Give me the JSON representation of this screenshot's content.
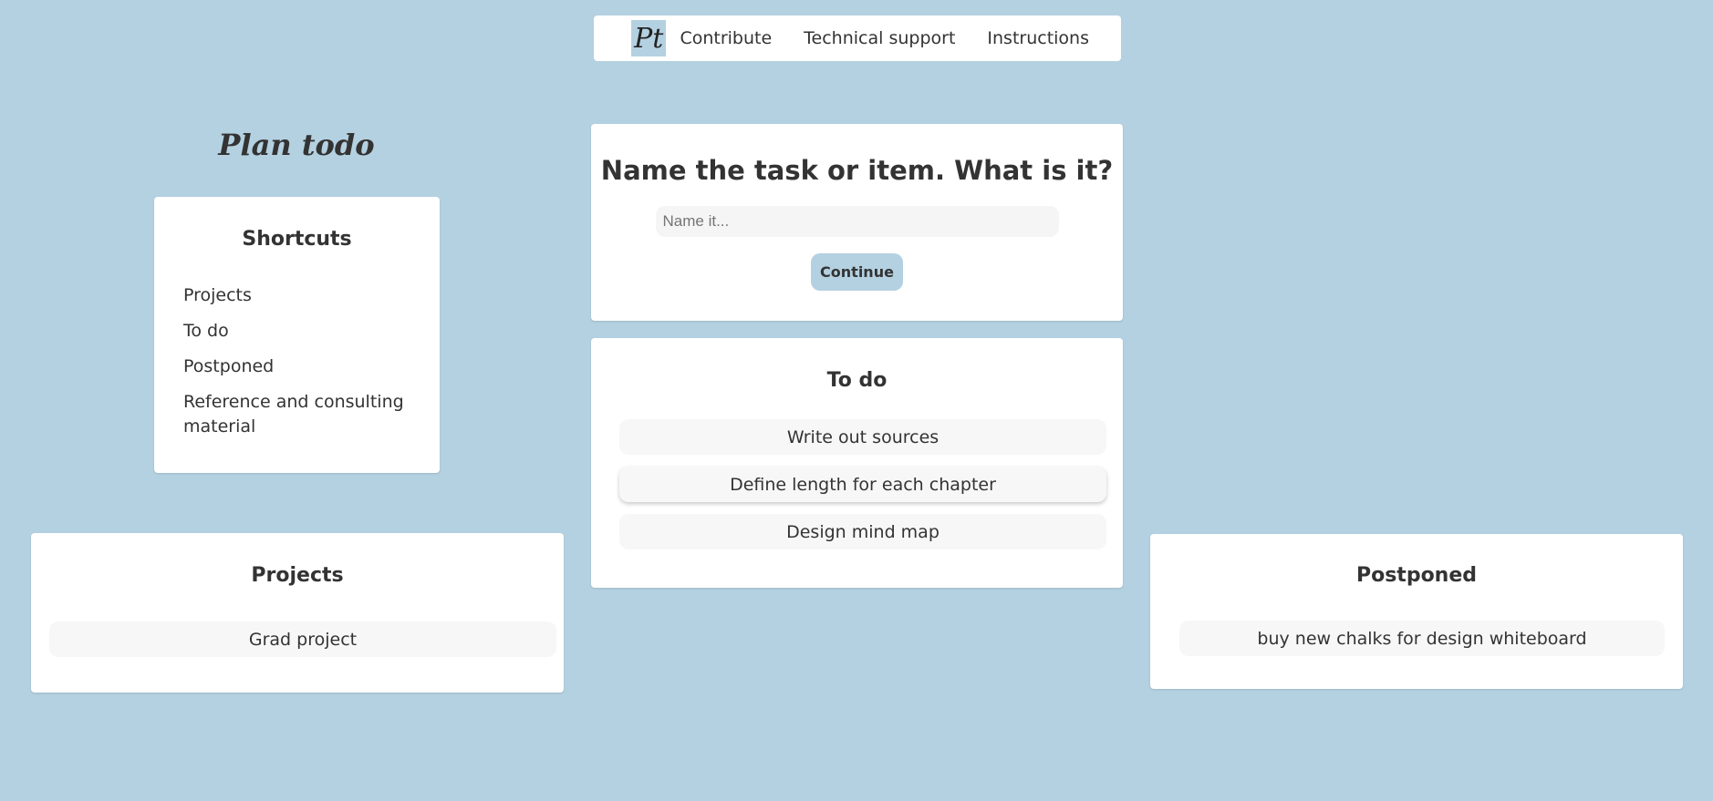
{
  "nav": {
    "logo_text": "Pt",
    "links": [
      "Contribute",
      "Technical support",
      "Instructions"
    ]
  },
  "brand": {
    "title": "Plan todo"
  },
  "shortcuts": {
    "title": "Shortcuts",
    "items": [
      "Projects",
      "To do",
      "Postponed",
      "Reference and consulting material"
    ]
  },
  "new_item": {
    "heading": "Name the task or item. What is it?",
    "input_placeholder": "Name it...",
    "input_value": "",
    "continue_label": "Continue"
  },
  "todo": {
    "title": "To do",
    "items": [
      "Write out sources",
      "Define length for each chapter",
      "Design mind map"
    ]
  },
  "projects": {
    "title": "Projects",
    "items": [
      "Grad project"
    ]
  },
  "postponed": {
    "title": "Postponed",
    "items": [
      "buy new chalks for design whiteboard"
    ]
  },
  "colors": {
    "background": "#b4d1e1",
    "card": "#ffffff",
    "item": "#f7f7f7",
    "text": "#333333",
    "accent": "#b4d1e1"
  }
}
